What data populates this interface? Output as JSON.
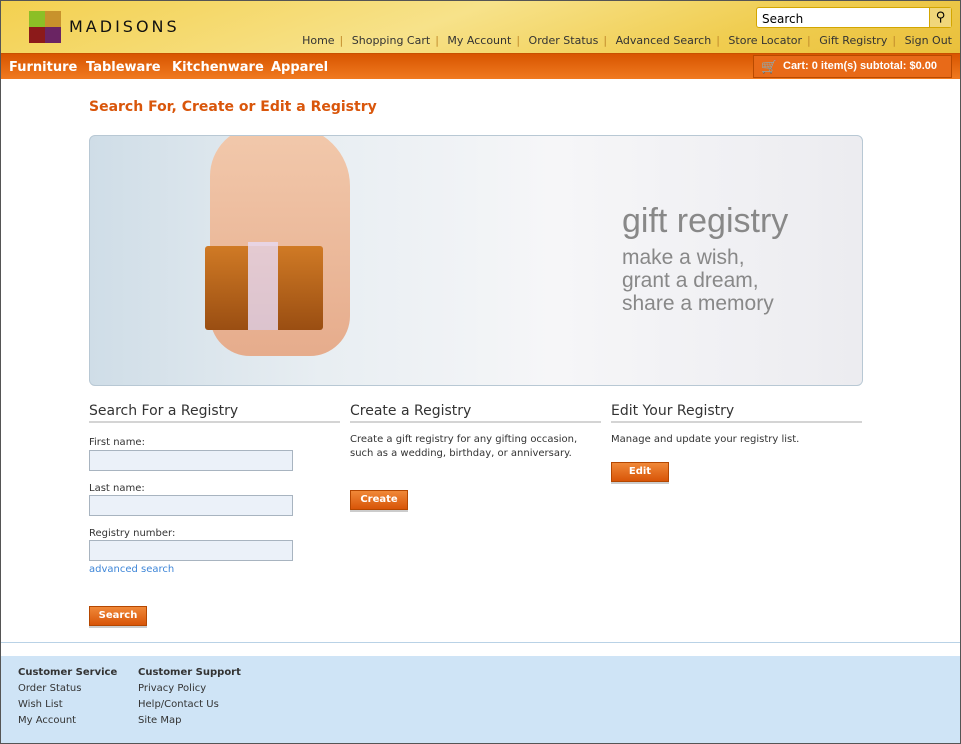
{
  "header": {
    "logo_text": "MADISONS",
    "search_placeholder": "Search",
    "links": [
      "Home",
      "Shopping Cart",
      "My Account",
      "Order Status",
      "Advanced Search",
      "Store Locator",
      "Gift Registry",
      "Sign Out"
    ]
  },
  "nav": {
    "items": [
      "Furniture",
      "Tableware",
      "Kitchenware",
      "Apparel"
    ],
    "cart": "Cart: 0 item(s) subtotal: $0.00"
  },
  "page": {
    "title": "Search For, Create or Edit a Registry"
  },
  "banner": {
    "headline": "gift registry",
    "lines": [
      "make a wish,",
      "grant a dream,",
      "share a memory"
    ]
  },
  "search": {
    "heading": "Search For a Registry",
    "first_name": "First name:",
    "last_name": "Last name:",
    "registry_number": "Registry number:",
    "advanced": "advanced search",
    "button": "Search"
  },
  "create": {
    "heading": "Create a Registry",
    "text": "Create a gift registry for any gifting occasion, such as a wedding, birthday, or anniversary.",
    "button": "Create"
  },
  "edit": {
    "heading": "Edit Your Registry",
    "text": "Manage and update your registry list.",
    "button": "Edit"
  },
  "footer": {
    "cs_title": "Customer Service",
    "cs_links": [
      "Order Status",
      "Wish List",
      "My Account"
    ],
    "sup_title": "Customer Support",
    "sup_links": [
      "Privacy Policy",
      "Help/Contact Us",
      "Site Map"
    ]
  },
  "colors": {
    "accent": "#d9560b",
    "nav": "#e86a18",
    "footer": "#cfe4f6"
  }
}
